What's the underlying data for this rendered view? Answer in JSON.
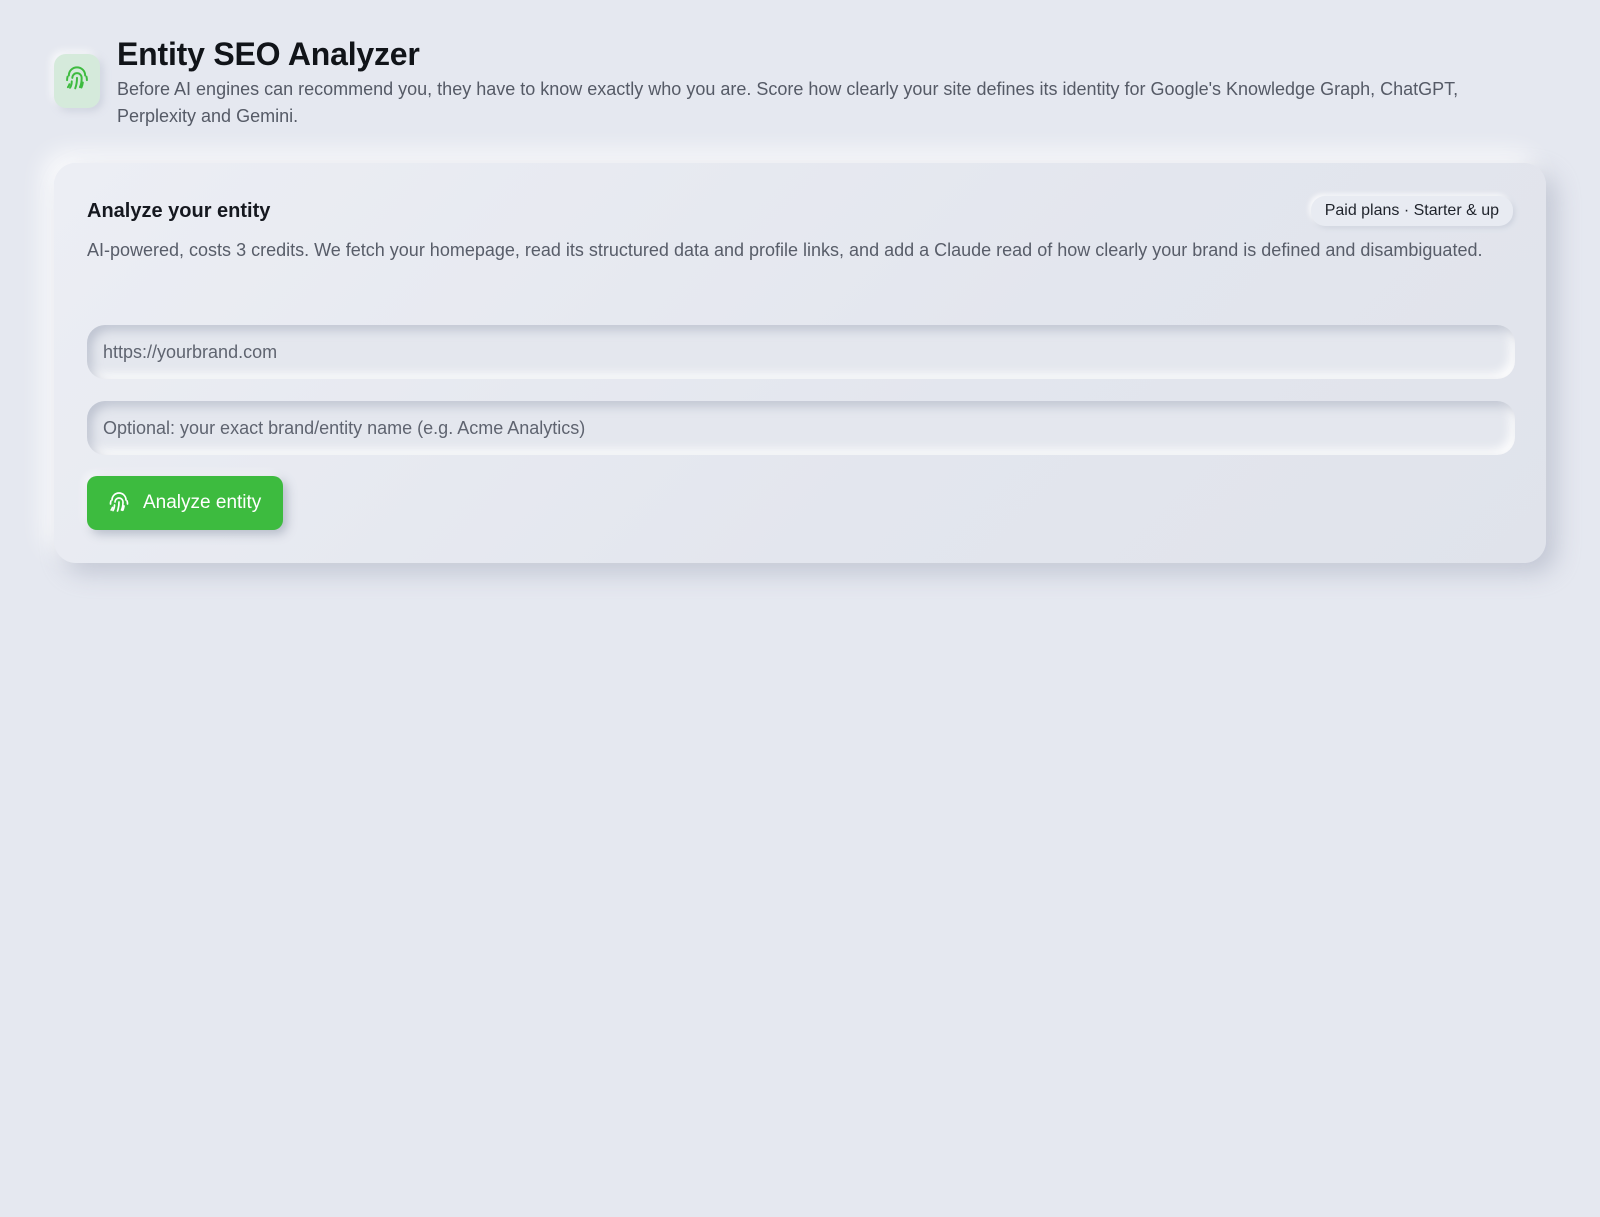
{
  "header": {
    "icon": "fingerprint-icon",
    "title": "Entity SEO Analyzer",
    "subtitle": "Before AI engines can recommend you, they have to know exactly who you are. Score how clearly your site defines its identity for Google's Knowledge Graph, ChatGPT, Perplexity and Gemini."
  },
  "card": {
    "title": "Analyze your entity",
    "badge": "Paid plans · Starter & up",
    "description": "AI-powered, costs 3 credits. We fetch your homepage, read its structured data and profile links, and add a Claude read of how clearly your brand is defined and disambiguated.",
    "url_input": {
      "value": "",
      "placeholder": "https://yourbrand.com"
    },
    "name_input": {
      "value": "",
      "placeholder": "Optional: your exact brand/entity name (e.g. Acme Analytics)"
    },
    "submit_label": "Analyze entity",
    "submit_icon": "fingerprint-icon"
  },
  "colors": {
    "background": "#e5e8f0",
    "accent": "#3dbb3f",
    "logo_tile": "#d5eadb"
  }
}
